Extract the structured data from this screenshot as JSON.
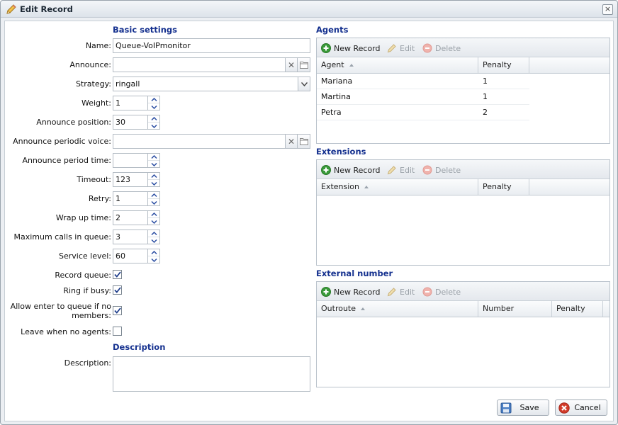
{
  "window": {
    "title": "Edit Record",
    "close_label": "×"
  },
  "sections": {
    "basic": "Basic settings",
    "description": "Description",
    "agents": "Agents",
    "extensions": "Extensions",
    "external": "External number"
  },
  "form": {
    "name": {
      "label": "Name:",
      "value": "Queue-VoIPmonitor"
    },
    "announce": {
      "label": "Announce:",
      "value": ""
    },
    "strategy": {
      "label": "Strategy:",
      "value": "ringall"
    },
    "weight": {
      "label": "Weight:",
      "value": "1"
    },
    "announce_position": {
      "label": "Announce position:",
      "value": "30"
    },
    "announce_periodic_voice": {
      "label": "Announce periodic voice:",
      "value": ""
    },
    "announce_period_time": {
      "label": "Announce period time:",
      "value": ""
    },
    "timeout": {
      "label": "Timeout:",
      "value": "123"
    },
    "retry": {
      "label": "Retry:",
      "value": "1"
    },
    "wrap_up_time": {
      "label": "Wrap up time:",
      "value": "2"
    },
    "max_calls": {
      "label": "Maximum calls in queue:",
      "value": "3"
    },
    "service_level": {
      "label": "Service level:",
      "value": "60"
    },
    "record_queue": {
      "label": "Record queue:",
      "checked": true
    },
    "ring_if_busy": {
      "label": "Ring if busy:",
      "checked": true
    },
    "allow_enter": {
      "label": "Allow enter to queue if no members:",
      "checked": true
    },
    "leave_when_no_agents": {
      "label": "Leave when no agents:",
      "checked": false
    },
    "description": {
      "label": "Description:",
      "value": ""
    }
  },
  "toolbar": {
    "new": "New Record",
    "edit": "Edit",
    "delete": "Delete"
  },
  "agents_grid": {
    "columns": [
      "Agent",
      "Penalty"
    ],
    "rows": [
      {
        "agent": "Mariana",
        "penalty": "1"
      },
      {
        "agent": "Martina",
        "penalty": "1"
      },
      {
        "agent": "Petra",
        "penalty": "2"
      }
    ]
  },
  "extensions_grid": {
    "columns": [
      "Extension",
      "Penalty"
    ]
  },
  "external_grid": {
    "columns": [
      "Outroute",
      "Number",
      "Penalty"
    ]
  },
  "buttons": {
    "save": "Save",
    "cancel": "Cancel"
  },
  "colors": {
    "section_title": "#15318f",
    "accent_green": "#3a9a3a",
    "cancel_red": "#d23b2a"
  }
}
